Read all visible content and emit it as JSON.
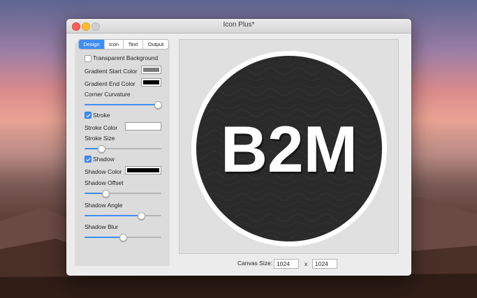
{
  "window": {
    "title": "Icon Plus*"
  },
  "tabs": [
    {
      "label": "Design",
      "active": true
    },
    {
      "label": "Icon",
      "active": false
    },
    {
      "label": "Text",
      "active": false
    },
    {
      "label": "Output",
      "active": false
    }
  ],
  "design": {
    "transparent_background": {
      "label": "Transparent Background",
      "checked": false
    },
    "gradient_start": {
      "label": "Gradient Start Color",
      "color": "#7a7a7a"
    },
    "gradient_end": {
      "label": "Gradient End Color",
      "color": "#000000"
    },
    "corner_curvature": {
      "label": "Corner Curvature",
      "value": 1.0
    },
    "stroke": {
      "label": "Stroke",
      "checked": true
    },
    "stroke_color": {
      "label": "Stroke Color",
      "color": "#ffffff"
    },
    "stroke_size": {
      "label": "Stroke Size",
      "value": 0.22
    },
    "shadow": {
      "label": "Shadow",
      "checked": true
    },
    "shadow_color": {
      "label": "Shadow Color",
      "color": "#000000"
    },
    "shadow_offset": {
      "label": "Shadow Offset",
      "value": 0.27
    },
    "shadow_angle": {
      "label": "Shadow Angle",
      "value": 0.74
    },
    "shadow_blur": {
      "label": "Shadow Blur",
      "value": 0.5
    }
  },
  "preview": {
    "text": "B2M",
    "text_color": "#ffffff",
    "bg_color": "#2a2a2a",
    "stroke_color": "#ffffff"
  },
  "canvas_size": {
    "label": "Canvas Size:",
    "width": "1024",
    "separator": "x",
    "height": "1024"
  }
}
